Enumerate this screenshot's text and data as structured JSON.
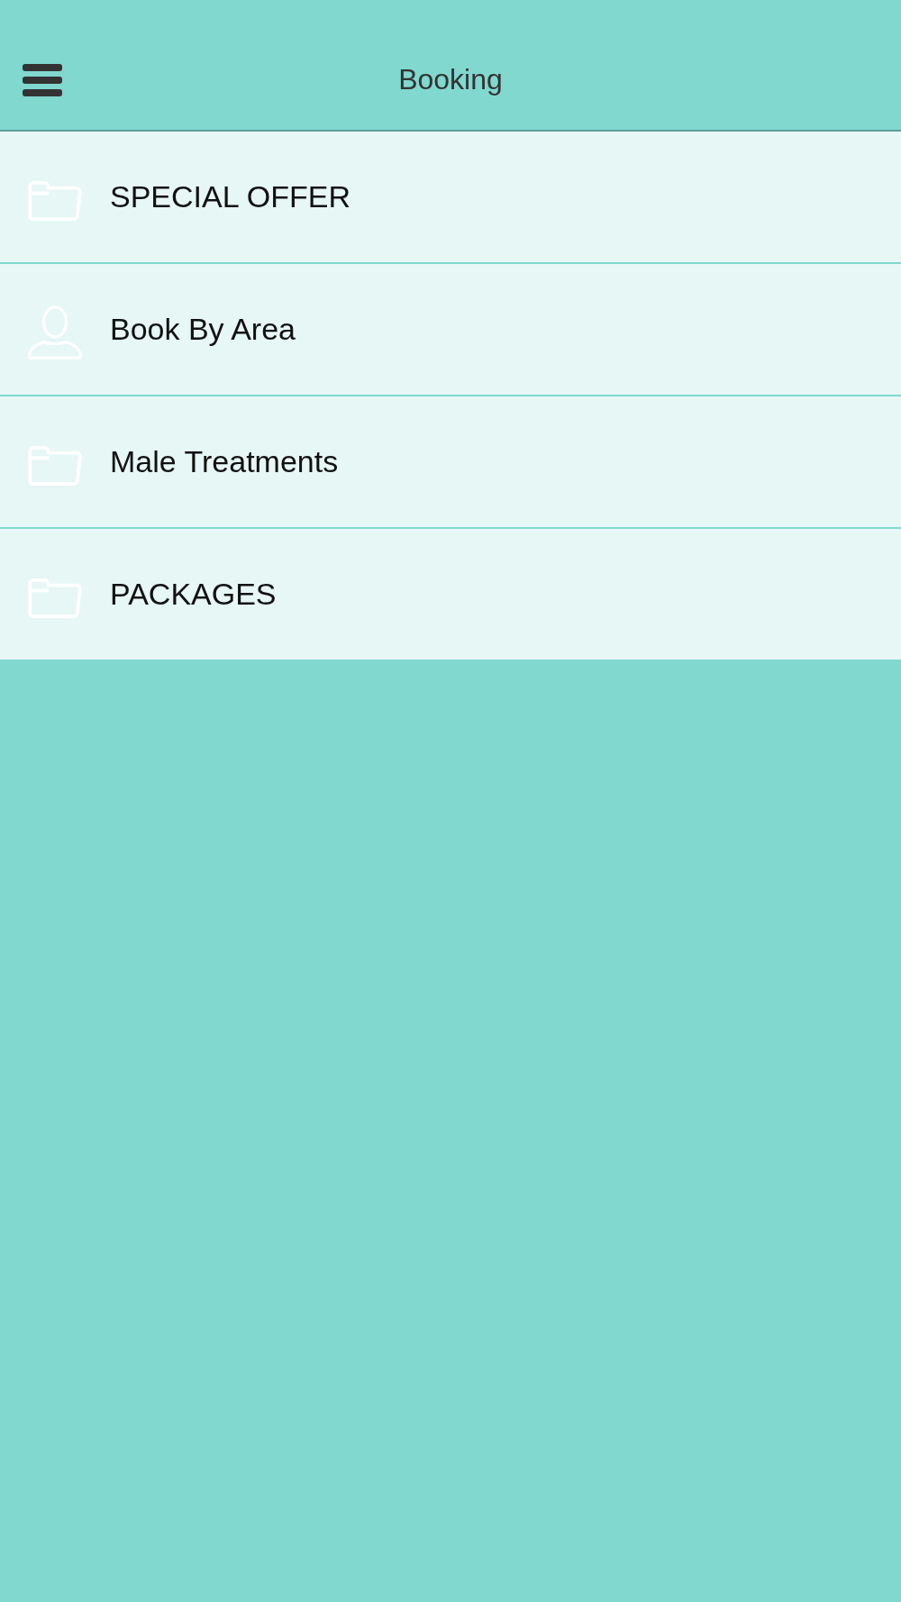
{
  "header": {
    "title": "Booking"
  },
  "menu_items": [
    {
      "label": "SPECIAL OFFER",
      "kind": "folder"
    },
    {
      "label": "Book By Area",
      "kind": "person"
    },
    {
      "label": "Male Treatments",
      "kind": "folder"
    },
    {
      "label": "PACKAGES",
      "kind": "folder"
    }
  ]
}
